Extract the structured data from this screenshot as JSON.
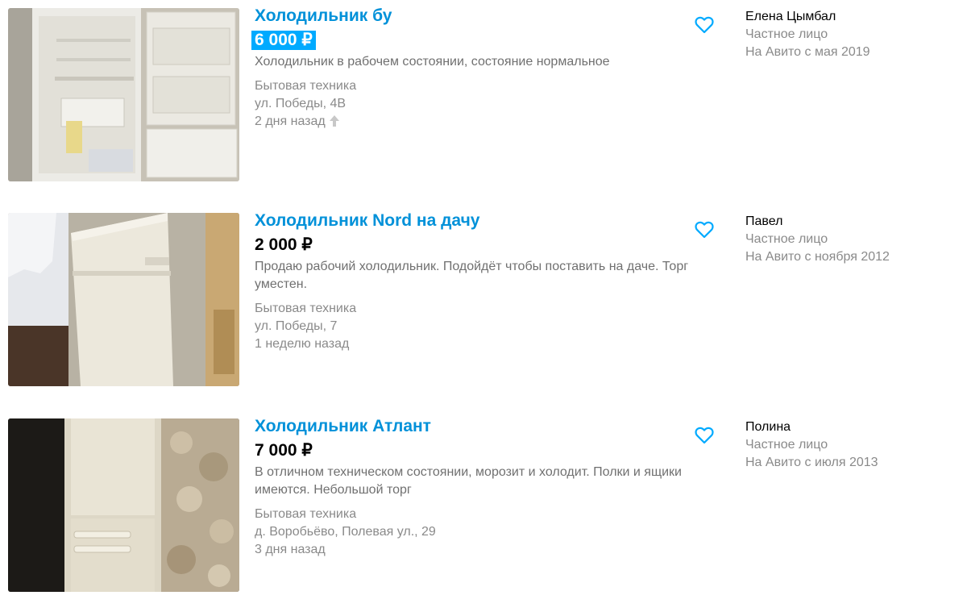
{
  "listings": [
    {
      "title": "Холодильник бу",
      "price": "6 000 ₽",
      "price_highlighted": true,
      "description": "Холодильник в рабочем состоянии, состояние нормальное",
      "category": "Бытовая техника",
      "address": "ул. Победы, 4В",
      "date": "2 дня назад",
      "raised": true,
      "favorite_icon": "heart-outline",
      "seller": {
        "name": "Елена Цымбал",
        "type": "Частное лицо",
        "since": "На Авито с мая 2019"
      }
    },
    {
      "title": "Холодильник Nord на дачу",
      "price": "2 000 ₽",
      "price_highlighted": false,
      "description": "Продаю рабочий холодильник. Подойдёт чтобы поставить на даче. Торг уместен.",
      "category": "Бытовая техника",
      "address": "ул. Победы, 7",
      "date": "1 неделю назад",
      "raised": false,
      "favorite_icon": "heart-outline",
      "seller": {
        "name": "Павел",
        "type": "Частное лицо",
        "since": "На Авито с ноября 2012"
      }
    },
    {
      "title": "Холодильник Атлант",
      "price": "7 000 ₽",
      "price_highlighted": false,
      "description": "В отличном техническом состоянии, морозит и холодит. Полки и ящики имеются. Небольшой торг",
      "category": "Бытовая техника",
      "address": "д. Воробьёво, Полевая ул., 29",
      "date": "3 дня назад",
      "raised": false,
      "favorite_icon": "heart-outline",
      "seller": {
        "name": "Полина",
        "type": "Частное лицо",
        "since": "На Авито с июля 2013"
      }
    }
  ],
  "colors": {
    "title_link": "#0091d9",
    "price_highlight_bg": "#00aaff",
    "muted_text": "#8a8a8a",
    "favorite_icon": "#00aaff"
  }
}
